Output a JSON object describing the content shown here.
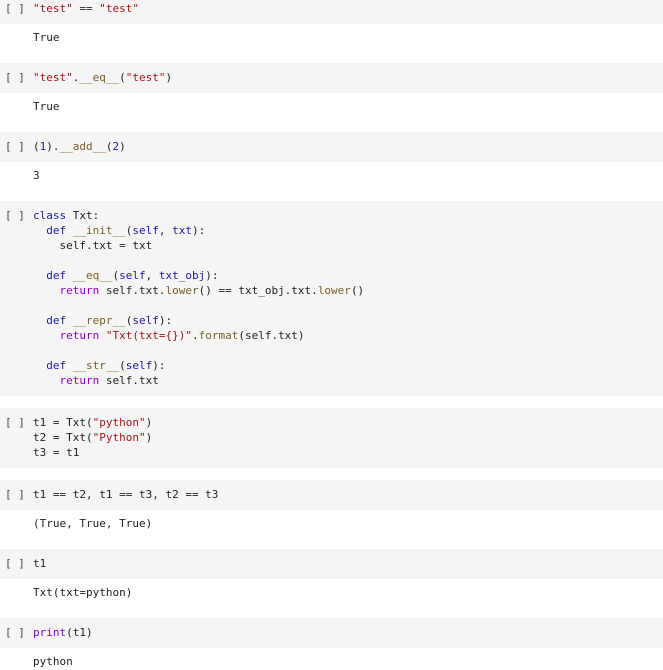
{
  "run_label": "[ ]",
  "cells": [
    {
      "code": [
        [
          {
            "t": "\"test\"",
            "c": "str"
          },
          {
            "t": " == ",
            "c": ""
          },
          {
            "t": "\"test\"",
            "c": "str"
          }
        ]
      ],
      "output": "True"
    },
    {
      "code": [
        [
          {
            "t": "\"test\"",
            "c": "str"
          },
          {
            "t": ".",
            "c": ""
          },
          {
            "t": "__eq__",
            "c": "fn"
          },
          {
            "t": "(",
            "c": ""
          },
          {
            "t": "\"test\"",
            "c": "str"
          },
          {
            "t": ")",
            "c": ""
          }
        ]
      ],
      "output": "True"
    },
    {
      "code": [
        [
          {
            "t": "(",
            "c": ""
          },
          {
            "t": "1",
            "c": "kw"
          },
          {
            "t": ").",
            "c": ""
          },
          {
            "t": "__add__",
            "c": "fn"
          },
          {
            "t": "(",
            "c": ""
          },
          {
            "t": "2",
            "c": "kw"
          },
          {
            "t": ")",
            "c": ""
          }
        ]
      ],
      "output": "3"
    },
    {
      "code": [
        [
          {
            "t": "class ",
            "c": "kw"
          },
          {
            "t": "Txt:",
            "c": ""
          }
        ],
        [
          {
            "t": "  ",
            "c": ""
          },
          {
            "t": "def ",
            "c": "kw"
          },
          {
            "t": "__init__",
            "c": "fn"
          },
          {
            "t": "(",
            "c": ""
          },
          {
            "t": "self",
            "c": "kw"
          },
          {
            "t": ", ",
            "c": ""
          },
          {
            "t": "txt",
            "c": "kw"
          },
          {
            "t": "):",
            "c": ""
          }
        ],
        [
          {
            "t": "    self.txt = txt",
            "c": ""
          }
        ],
        [
          {
            "t": "",
            "c": ""
          }
        ],
        [
          {
            "t": "  ",
            "c": ""
          },
          {
            "t": "def ",
            "c": "kw"
          },
          {
            "t": "__eq__",
            "c": "fn"
          },
          {
            "t": "(",
            "c": ""
          },
          {
            "t": "self",
            "c": "kw"
          },
          {
            "t": ", ",
            "c": ""
          },
          {
            "t": "txt_obj",
            "c": "kw"
          },
          {
            "t": "):",
            "c": ""
          }
        ],
        [
          {
            "t": "    ",
            "c": ""
          },
          {
            "t": "return ",
            "c": "ret"
          },
          {
            "t": "self.txt.",
            "c": ""
          },
          {
            "t": "lower",
            "c": "fn"
          },
          {
            "t": "() == txt_obj.txt.",
            "c": ""
          },
          {
            "t": "lower",
            "c": "fn"
          },
          {
            "t": "()",
            "c": ""
          }
        ],
        [
          {
            "t": "",
            "c": ""
          }
        ],
        [
          {
            "t": "  ",
            "c": ""
          },
          {
            "t": "def ",
            "c": "kw"
          },
          {
            "t": "__repr__",
            "c": "fn"
          },
          {
            "t": "(",
            "c": ""
          },
          {
            "t": "self",
            "c": "kw"
          },
          {
            "t": "):",
            "c": ""
          }
        ],
        [
          {
            "t": "    ",
            "c": ""
          },
          {
            "t": "return ",
            "c": "ret"
          },
          {
            "t": "\"Txt(txt={})\"",
            "c": "str"
          },
          {
            "t": ".",
            "c": ""
          },
          {
            "t": "format",
            "c": "fn"
          },
          {
            "t": "(self.txt)",
            "c": ""
          }
        ],
        [
          {
            "t": "",
            "c": ""
          }
        ],
        [
          {
            "t": "  ",
            "c": ""
          },
          {
            "t": "def ",
            "c": "kw"
          },
          {
            "t": "__str__",
            "c": "fn"
          },
          {
            "t": "(",
            "c": ""
          },
          {
            "t": "self",
            "c": "kw"
          },
          {
            "t": "):",
            "c": ""
          }
        ],
        [
          {
            "t": "    ",
            "c": ""
          },
          {
            "t": "return ",
            "c": "ret"
          },
          {
            "t": "self.txt",
            "c": ""
          }
        ]
      ],
      "output": null
    },
    {
      "code": [
        [
          {
            "t": "t1 = Txt(",
            "c": ""
          },
          {
            "t": "\"python\"",
            "c": "str"
          },
          {
            "t": ")",
            "c": ""
          }
        ],
        [
          {
            "t": "t2 = Txt(",
            "c": ""
          },
          {
            "t": "\"Python\"",
            "c": "str"
          },
          {
            "t": ")",
            "c": ""
          }
        ],
        [
          {
            "t": "t3 = t1",
            "c": ""
          }
        ]
      ],
      "output": null
    },
    {
      "code": [
        [
          {
            "t": "t1 == t2, t1 == t3, t2 == t3",
            "c": ""
          }
        ]
      ],
      "output": "(True, True, True)"
    },
    {
      "code": [
        [
          {
            "t": "t1",
            "c": ""
          }
        ]
      ],
      "output": "Txt(txt=python)"
    },
    {
      "code": [
        [
          {
            "t": "print",
            "c": "ret"
          },
          {
            "t": "(t1)",
            "c": ""
          }
        ]
      ],
      "output": "python"
    }
  ]
}
